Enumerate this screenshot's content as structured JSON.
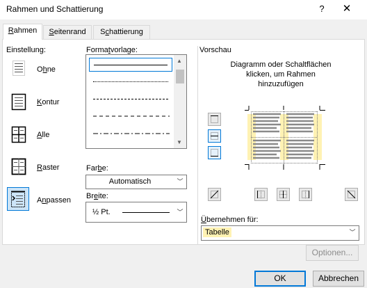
{
  "window": {
    "title": "Rahmen und Schattierung",
    "help_glyph": "?",
    "close_glyph": "✕"
  },
  "tabs": [
    {
      "label": "Rahmen",
      "active": true
    },
    {
      "label": "Seitenrand",
      "active": false
    },
    {
      "label": "Schattierung",
      "active": false
    }
  ],
  "einstellung": {
    "heading": "Einstellung:",
    "items": [
      {
        "label": "Ohne",
        "icon": "none-border-icon",
        "selected": false
      },
      {
        "label": "Kontur",
        "icon": "box-border-icon",
        "selected": false
      },
      {
        "label": "Alle",
        "icon": "all-borders-icon",
        "selected": false
      },
      {
        "label": "Raster",
        "icon": "grid-border-icon",
        "selected": false
      },
      {
        "label": "Anpassen",
        "icon": "custom-border-icon",
        "selected": true
      }
    ]
  },
  "formatvorlage": {
    "heading": "Formatvorlage:",
    "styles": [
      "solid",
      "dotted",
      "dashed-small",
      "dashed",
      "dash-dot"
    ],
    "selected_index": 0
  },
  "farbe": {
    "label": "Farbe:",
    "value": "Automatisch"
  },
  "breite": {
    "label": "Breite:",
    "value": "½ Pt."
  },
  "vorschau": {
    "heading": "Vorschau",
    "hint_line1": "Diagramm oder Schaltflächen",
    "hint_line2": "klicken, um Rahmen",
    "hint_line3": "hinzuzufügen"
  },
  "uebernehmen": {
    "label": "Übernehmen für:",
    "value": "Tabelle"
  },
  "buttons": {
    "options": "Optionen...",
    "ok": "OK",
    "cancel": "Abbrechen"
  },
  "colors": {
    "accent": "#0078d7",
    "highlight": "#fff2b3",
    "selection": "#cce4f7"
  }
}
